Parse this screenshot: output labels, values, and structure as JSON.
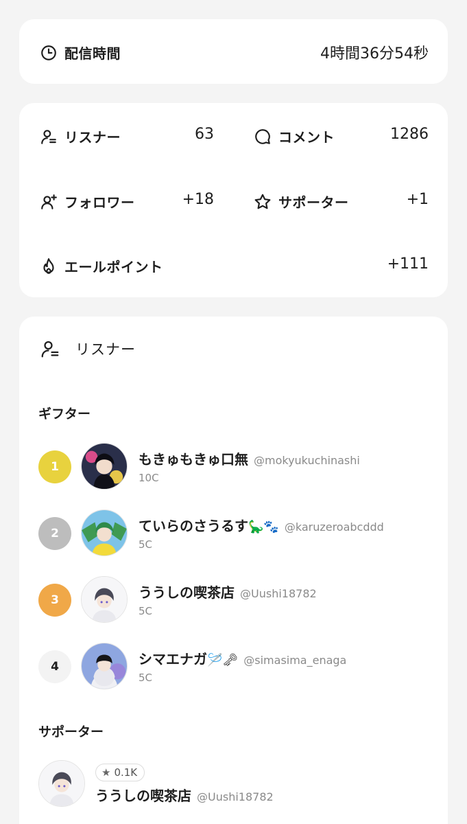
{
  "stream_time": {
    "label": "配信時間",
    "value": "4時間36分54秒"
  },
  "stats": [
    {
      "label": "リスナー",
      "value": "63",
      "icon": "listener-icon"
    },
    {
      "label": "コメント",
      "value": "1286",
      "icon": "comment-icon"
    },
    {
      "label": "フォロワー",
      "value": "+18",
      "icon": "follower-icon"
    },
    {
      "label": "サポーター",
      "value": "+1",
      "icon": "star-icon"
    },
    {
      "label": "エールポイント",
      "value": "+111",
      "icon": "flame-icon"
    }
  ],
  "listeners": {
    "title": "リスナー",
    "gifter_heading": "ギフター",
    "gifters": [
      {
        "rank": "1",
        "name": "もきゅもきゅ口無",
        "handle": "@mokyukuchinashi",
        "coins": "10C",
        "rank_color": "#e8d23e"
      },
      {
        "rank": "2",
        "name": "ていらのさうるす",
        "emoji": "🦕🐾",
        "handle": "@karuzeroabcddd",
        "coins": "5C",
        "rank_color": "#bdbdbd"
      },
      {
        "rank": "3",
        "name": "ううしの喫茶店",
        "handle": "@Uushi18782",
        "coins": "5C",
        "rank_color": "#f0a848"
      },
      {
        "rank": "4",
        "name": "シマエナガ",
        "emoji": "🪡🗝",
        "handle": "@simasima_enaga",
        "coins": "5C",
        "rank_color": "#f3f3f3"
      }
    ],
    "supporter_heading": "サポーター",
    "supporters": [
      {
        "name": "ううしの喫茶店",
        "handle": "@Uushi18782",
        "badge": "0.1K"
      }
    ]
  },
  "colors": {
    "background": "#f4f4f4",
    "card": "#ffffff",
    "text": "#1e1e1e",
    "muted": "#8a8a8a"
  }
}
